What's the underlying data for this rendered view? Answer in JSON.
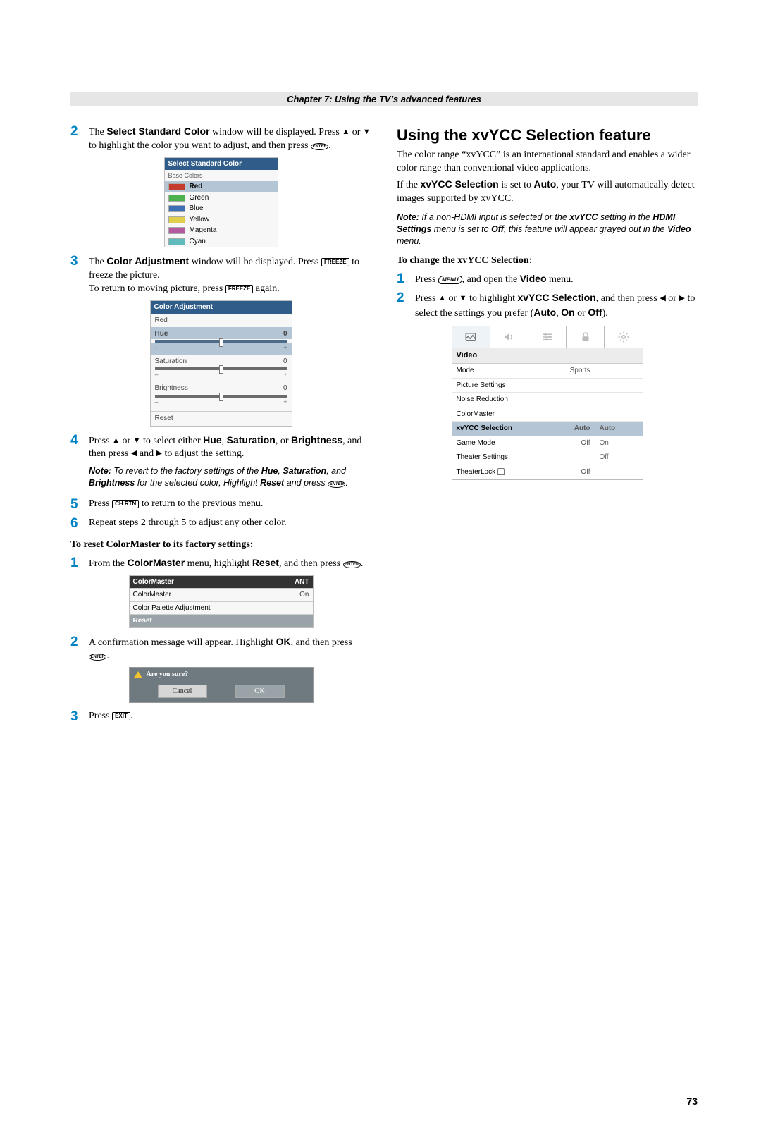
{
  "chapter": "Chapter 7: Using the TV’s advanced features",
  "left": {
    "step2": {
      "p1a": "The ",
      "p1b": "Select Standard Color",
      "p1c": " window will be displayed. Press ",
      "p1d": " or ",
      "p1e": " to highlight the color you want to adjust, and then press ",
      "p1f": "."
    },
    "selectColor": {
      "title": "Select Standard Color",
      "subtitle": "Base Colors",
      "items": [
        "Red",
        "Green",
        "Blue",
        "Yellow",
        "Magenta",
        "Cyan"
      ]
    },
    "step3": {
      "p1a": "The ",
      "p1b": "Color Adjustment",
      "p1c": " window will be displayed. Press ",
      "p1d": " to freeze the picture.",
      "p2a": "To return to moving picture, press ",
      "p2b": " again."
    },
    "colorAdj": {
      "title": "Color Adjustment",
      "rows": {
        "red": "Red",
        "hue": "Hue",
        "sat": "Saturation",
        "bri": "Brightness",
        "reset": "Reset"
      },
      "val0": "0",
      "minus": "–",
      "plus": "+"
    },
    "step4": {
      "a": "Press ",
      "b": " or ",
      "c": " to select either ",
      "hue": "Hue",
      "d": ", ",
      "sat": "Saturation",
      "e": ", or ",
      "bri": "Brightness",
      "f": ", and then press ",
      "g": " and ",
      "h": " to adjust the setting."
    },
    "note4": {
      "label": "Note:",
      "a": " To revert to the factory settings of the ",
      "hue": "Hue",
      "b": ", ",
      "sat": "Saturation",
      "c": ", and ",
      "bri": "Brightness",
      "d": " for the selected color, Highlight ",
      "reset": "Reset",
      "e": " and press ",
      "f": "."
    },
    "step5": {
      "a": "Press ",
      "b": " to return to the previous menu."
    },
    "step6": "Repeat steps 2 through 5 to adjust any other color.",
    "resetHead": "To reset ColorMaster to its factory settings:",
    "rstep1": {
      "a": "From the ",
      "b": "ColorMaster",
      "c": " menu, highlight ",
      "d": "Reset",
      "e": ", and then press ",
      "f": "."
    },
    "cmTable": {
      "headL": "ColorMaster",
      "headR": "ANT",
      "r1l": "ColorMaster",
      "r1r": "On",
      "r2l": "Color Palette Adjustment",
      "r3l": "Reset"
    },
    "rstep2": {
      "a": "A confirmation message will appear. Highlight ",
      "ok": "OK",
      "b": ", and then press ",
      "c": "."
    },
    "confirm": {
      "msg": "Are you sure?",
      "cancel": "Cancel",
      "ok": "OK"
    },
    "rstep3": {
      "a": "Press ",
      "b": "."
    }
  },
  "right": {
    "title": "Using the xvYCC Selection feature",
    "p1": "The color range “xvYCC” is an international standard and enables a wider color range than conventional video applications.",
    "p2a": "If the ",
    "p2b": "xvYCC Selection",
    "p2c": " is set to ",
    "p2d": "Auto",
    "p2e": ", your TV will automatically detect images supported by xvYCC.",
    "note": {
      "label": "Note:",
      "a": " If a non-HDMI input is selected or the ",
      "b": "xvYCC",
      "c": " setting in the ",
      "d": "HDMI Settings",
      "e": " menu is set to ",
      "f": "Off",
      "g": ", this feature will appear grayed out in the ",
      "h": "Video",
      "i": " menu."
    },
    "subhead": "To change the xvYCC Selection:",
    "s1a": "Press ",
    "s1b": ", and open the ",
    "s1c": "Video",
    "s1d": " menu.",
    "s2a": "Press ",
    "s2b": " or ",
    "s2c": " to highlight ",
    "s2d": "xvYCC Selection",
    "s2e": ", and then press ",
    "s2f": " or ",
    "s2g": " to select the settings you prefer (",
    "s2h": "Auto",
    "s2i": ", ",
    "s2j": "On",
    "s2k": " or ",
    "s2l": "Off",
    "s2m": ").",
    "vmenu": {
      "title": "Video",
      "rows": [
        {
          "a": "Mode",
          "b": "Sports",
          "c": ""
        },
        {
          "a": "Picture Settings",
          "b": "",
          "c": ""
        },
        {
          "a": "Noise Reduction",
          "b": "",
          "c": ""
        },
        {
          "a": "ColorMaster",
          "b": "",
          "c": ""
        },
        {
          "a": "xvYCC Selection",
          "b": "Auto",
          "c": "Auto",
          "sel": true
        },
        {
          "a": "Game Mode",
          "b": "Off",
          "c": "On"
        },
        {
          "a": "Theater Settings",
          "b": "",
          "c": "Off"
        },
        {
          "a": "TheaterLock",
          "b": "Off",
          "c": "",
          "lock": true
        }
      ]
    }
  },
  "buttons": {
    "freeze": "FREEZE",
    "enter": "ENTER",
    "rtn": "CH RTN",
    "exit": "EXIT",
    "menu": "MENU"
  },
  "pageNum": "73"
}
